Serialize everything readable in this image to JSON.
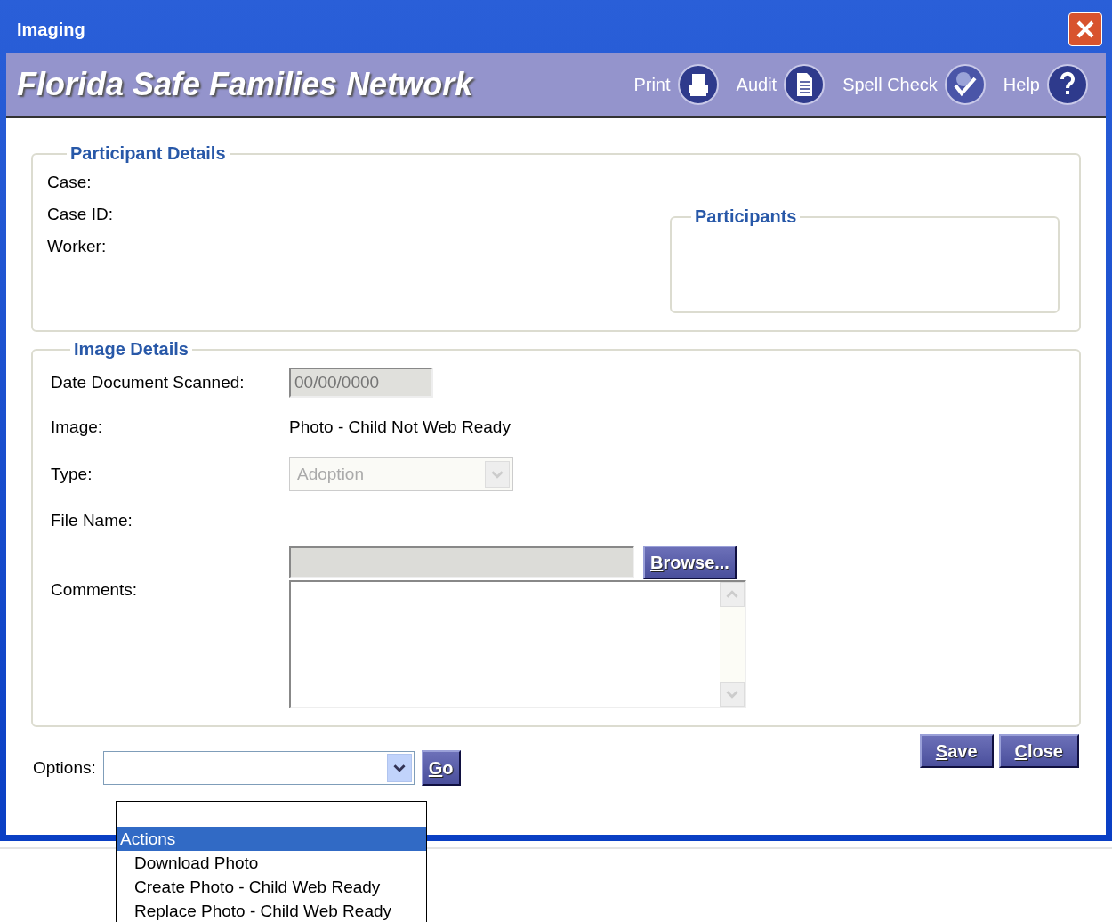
{
  "window": {
    "title": "Imaging"
  },
  "banner": {
    "title": "Florida Safe Families Network",
    "actions": [
      {
        "label": "Print",
        "kind": "print"
      },
      {
        "label": "Audit",
        "kind": "audit"
      },
      {
        "label": "Spell Check",
        "kind": "spell"
      },
      {
        "label": "Help",
        "kind": "help"
      }
    ]
  },
  "participant_details": {
    "title": "Participant Details",
    "fields": [
      "Case:",
      "Case ID:",
      "Worker:"
    ],
    "participants": {
      "title": "Participants"
    }
  },
  "image_details": {
    "title": "Image Details",
    "date": {
      "label": "Date Document Scanned:",
      "placeholder": "00/00/0000",
      "disabled": true
    },
    "image": {
      "label": "Image:",
      "value": "Photo - Child Not Web Ready"
    },
    "type": {
      "label": "Type:",
      "value": "Adoption",
      "disabled": true
    },
    "file": {
      "label": "File Name:",
      "disabled": true,
      "browse_button": "Browse..."
    },
    "comments": {
      "label": "Comments:"
    }
  },
  "options": {
    "label": "Options:",
    "go_button": "Go",
    "menu": [
      {
        "label": "Actions",
        "kind": "group",
        "selected": true
      },
      {
        "label": "Download Photo",
        "kind": "option",
        "selected": false
      },
      {
        "label": "Create Photo - Child Web Ready",
        "kind": "option",
        "selected": false
      },
      {
        "label": "Replace Photo - Child Web Ready",
        "kind": "option",
        "selected": false
      }
    ]
  },
  "buttons": [
    "Save",
    "Close"
  ]
}
